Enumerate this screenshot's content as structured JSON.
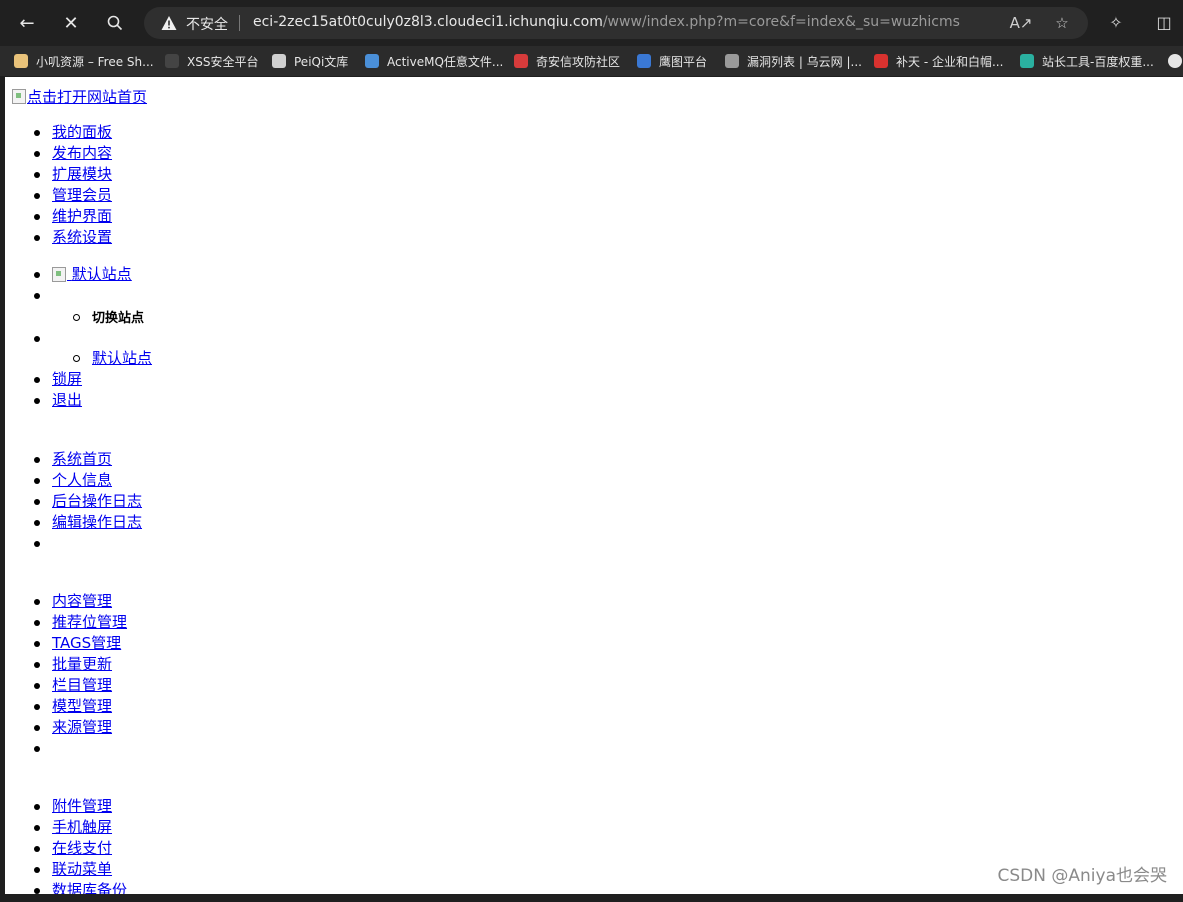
{
  "browser": {
    "insecure_label": "不安全",
    "url_host": "eci-2zec15at0t0culy0z8l3.cloudeci1.ichunqiu.com",
    "url_path": "/www/index.php?m=core&f=index&_su=wuzhicms",
    "bookmarks": [
      {
        "label": "小叽资源 – Free Sh...",
        "color": "#e8c27a"
      },
      {
        "label": "XSS安全平台",
        "color": "#444444"
      },
      {
        "label": "PeiQi文库",
        "color": "#cfcfcf"
      },
      {
        "label": "ActiveMQ任意文件...",
        "color": "#4a8fd8"
      },
      {
        "label": "奇安信攻防社区",
        "color": "#d63b3b"
      },
      {
        "label": "鹰图平台",
        "color": "#3a78d4"
      },
      {
        "label": "漏洞列表 | 乌云网 |...",
        "color": "#9a9a9a"
      },
      {
        "label": "补天 - 企业和白帽...",
        "color": "#d8322f"
      },
      {
        "label": "站长工具-百度权重...",
        "color": "#2ab0a0"
      }
    ]
  },
  "header": {
    "logo_alt": "点击打开网站首页"
  },
  "top_nav": [
    "我的面板",
    "发布内容",
    "扩展模块",
    "管理会员",
    "维护界面",
    "系统设置"
  ],
  "site_menu": {
    "current": "默认站点",
    "switch_heading": "切换站点",
    "option": "默认站点",
    "lock": "锁屏",
    "logout": "退出"
  },
  "panel_menu": [
    "系统首页",
    "个人信息",
    "后台操作日志",
    "编辑操作日志"
  ],
  "content_menu": [
    "内容管理",
    "推荐位管理",
    "TAGS管理",
    "批量更新",
    "栏目管理",
    "模型管理",
    "来源管理"
  ],
  "extension_menu": [
    "附件管理",
    "手机触屏",
    "在线支付",
    "联动菜单",
    "数据库备份"
  ],
  "watermark": "CSDN @Aniya也会哭"
}
